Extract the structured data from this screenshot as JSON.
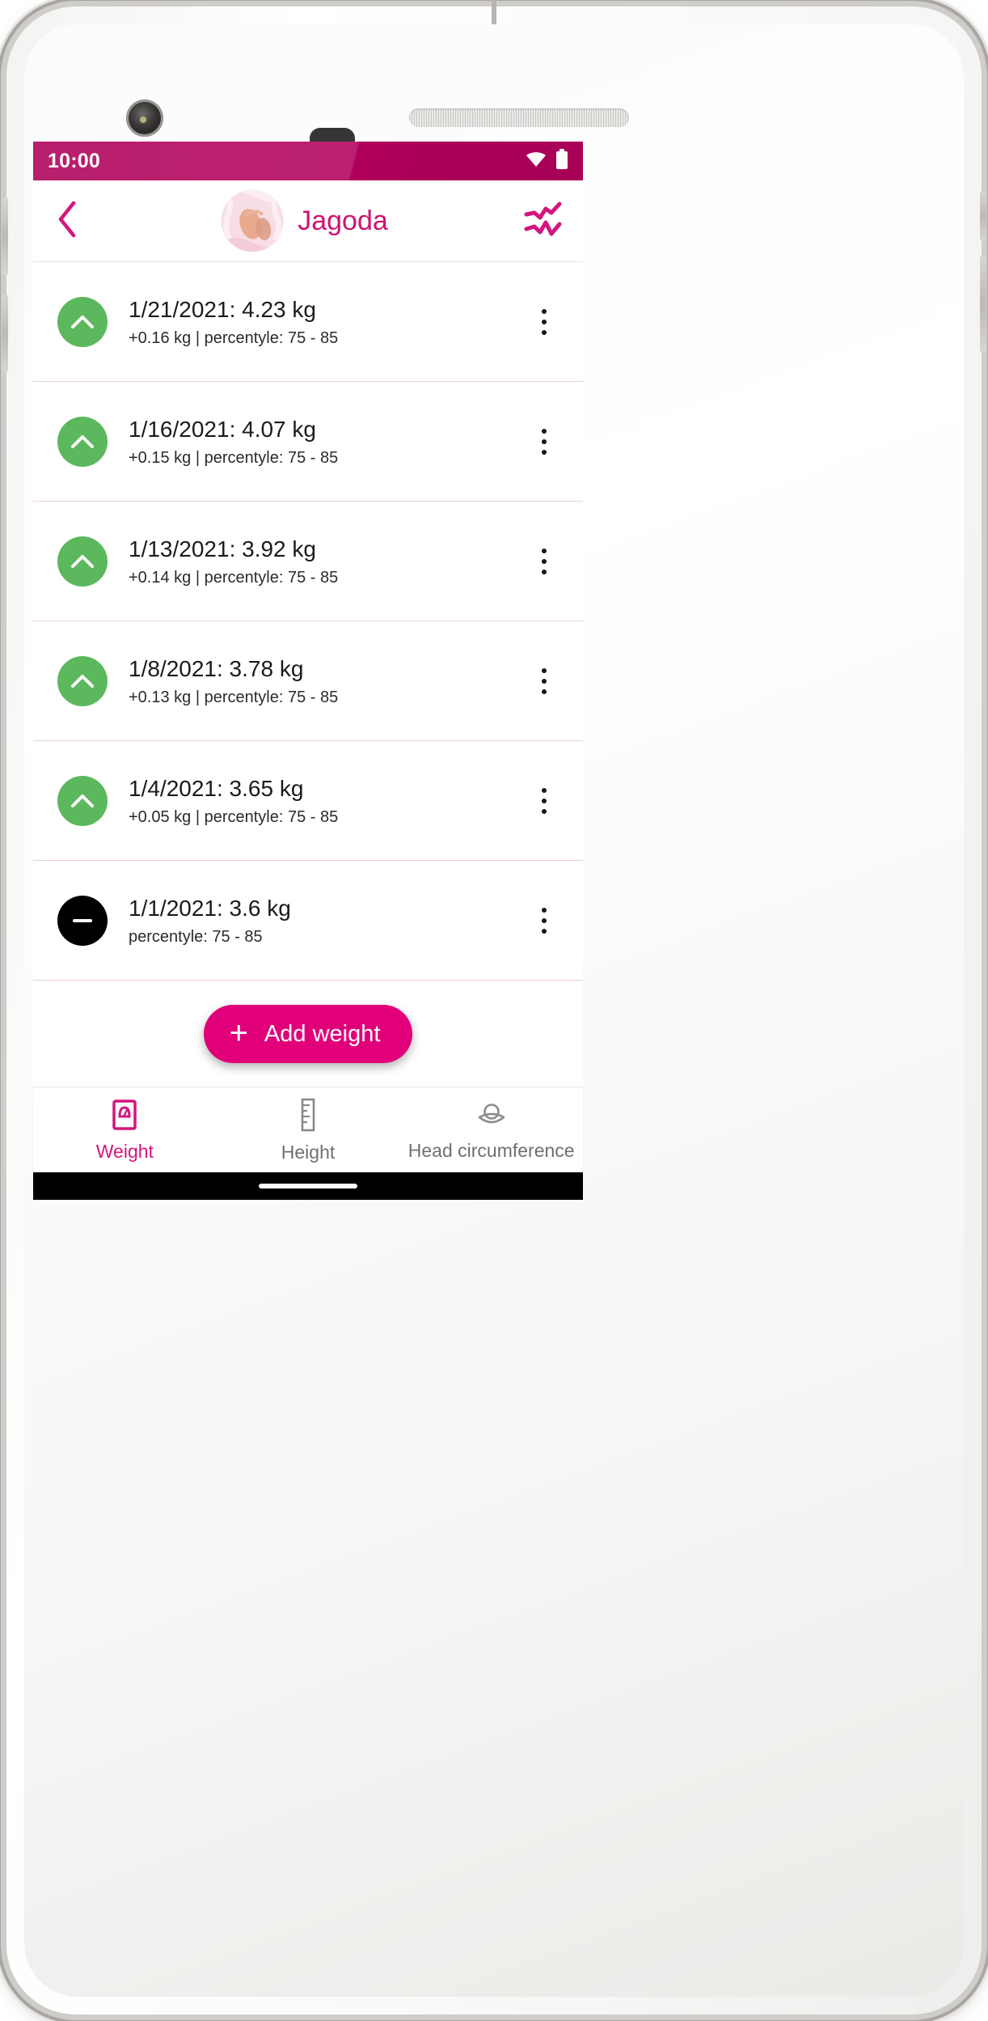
{
  "status_bar": {
    "time": "10:00",
    "wifi_icon": "wifi-icon",
    "battery_icon": "battery-full-icon",
    "background_color": "#b81f6d"
  },
  "app_bar": {
    "back_icon": "chevron-left-icon",
    "avatar_name": "baby-feet-avatar",
    "title": "Jagoda",
    "chart_icon": "growth-chart-icon",
    "accent_color": "#cf1272"
  },
  "measurements": {
    "unit": "kg",
    "rows": [
      {
        "trend": "up",
        "trend_icon": "chevron-up-icon",
        "title": "1/21/2021: 4.23 kg",
        "subtitle": "+0.16 kg | percentyle: 75 - 85",
        "date": "1/21/2021",
        "value": "4.23",
        "delta": "+0.16 kg",
        "percentile": "75 - 85",
        "menu_icon": "kebab-menu-icon",
        "badge_color": "#5cb85c"
      },
      {
        "trend": "up",
        "trend_icon": "chevron-up-icon",
        "title": "1/16/2021: 4.07 kg",
        "subtitle": "+0.15 kg | percentyle: 75 - 85",
        "date": "1/16/2021",
        "value": "4.07",
        "delta": "+0.15 kg",
        "percentile": "75 - 85",
        "menu_icon": "kebab-menu-icon",
        "badge_color": "#5cb85c"
      },
      {
        "trend": "up",
        "trend_icon": "chevron-up-icon",
        "title": "1/13/2021: 3.92 kg",
        "subtitle": "+0.14 kg | percentyle: 75 - 85",
        "date": "1/13/2021",
        "value": "3.92",
        "delta": "+0.14 kg",
        "percentile": "75 - 85",
        "menu_icon": "kebab-menu-icon",
        "badge_color": "#5cb85c"
      },
      {
        "trend": "up",
        "trend_icon": "chevron-up-icon",
        "title": "1/8/2021: 3.78 kg",
        "subtitle": "+0.13 kg | percentyle: 75 - 85",
        "date": "1/8/2021",
        "value": "3.78",
        "delta": "+0.13 kg",
        "percentile": "75 - 85",
        "menu_icon": "kebab-menu-icon",
        "badge_color": "#5cb85c"
      },
      {
        "trend": "up",
        "trend_icon": "chevron-up-icon",
        "title": "1/4/2021: 3.65 kg",
        "subtitle": "+0.05 kg | percentyle: 75 - 85",
        "date": "1/4/2021",
        "value": "3.65",
        "delta": "+0.05 kg",
        "percentile": "75 - 85",
        "menu_icon": "kebab-menu-icon",
        "badge_color": "#5cb85c"
      },
      {
        "trend": "flat",
        "trend_icon": "minus-icon",
        "title": "1/1/2021: 3.6 kg",
        "subtitle": "percentyle: 75 - 85",
        "date": "1/1/2021",
        "value": "3.6",
        "delta": "",
        "percentile": "75 - 85",
        "menu_icon": "kebab-menu-icon",
        "badge_color": "#000000"
      }
    ]
  },
  "fab": {
    "label": "Add weight",
    "plus_icon": "plus-icon",
    "background_color": "#e2007a"
  },
  "bottom_nav": {
    "active_color": "#d4157e",
    "inactive_color": "#6f6f6f",
    "items": [
      {
        "label": "Weight",
        "icon": "scale-icon",
        "active": true
      },
      {
        "label": "Height",
        "icon": "ruler-icon",
        "active": false
      },
      {
        "label": "Head circumference",
        "icon": "head-icon",
        "active": false
      }
    ]
  }
}
